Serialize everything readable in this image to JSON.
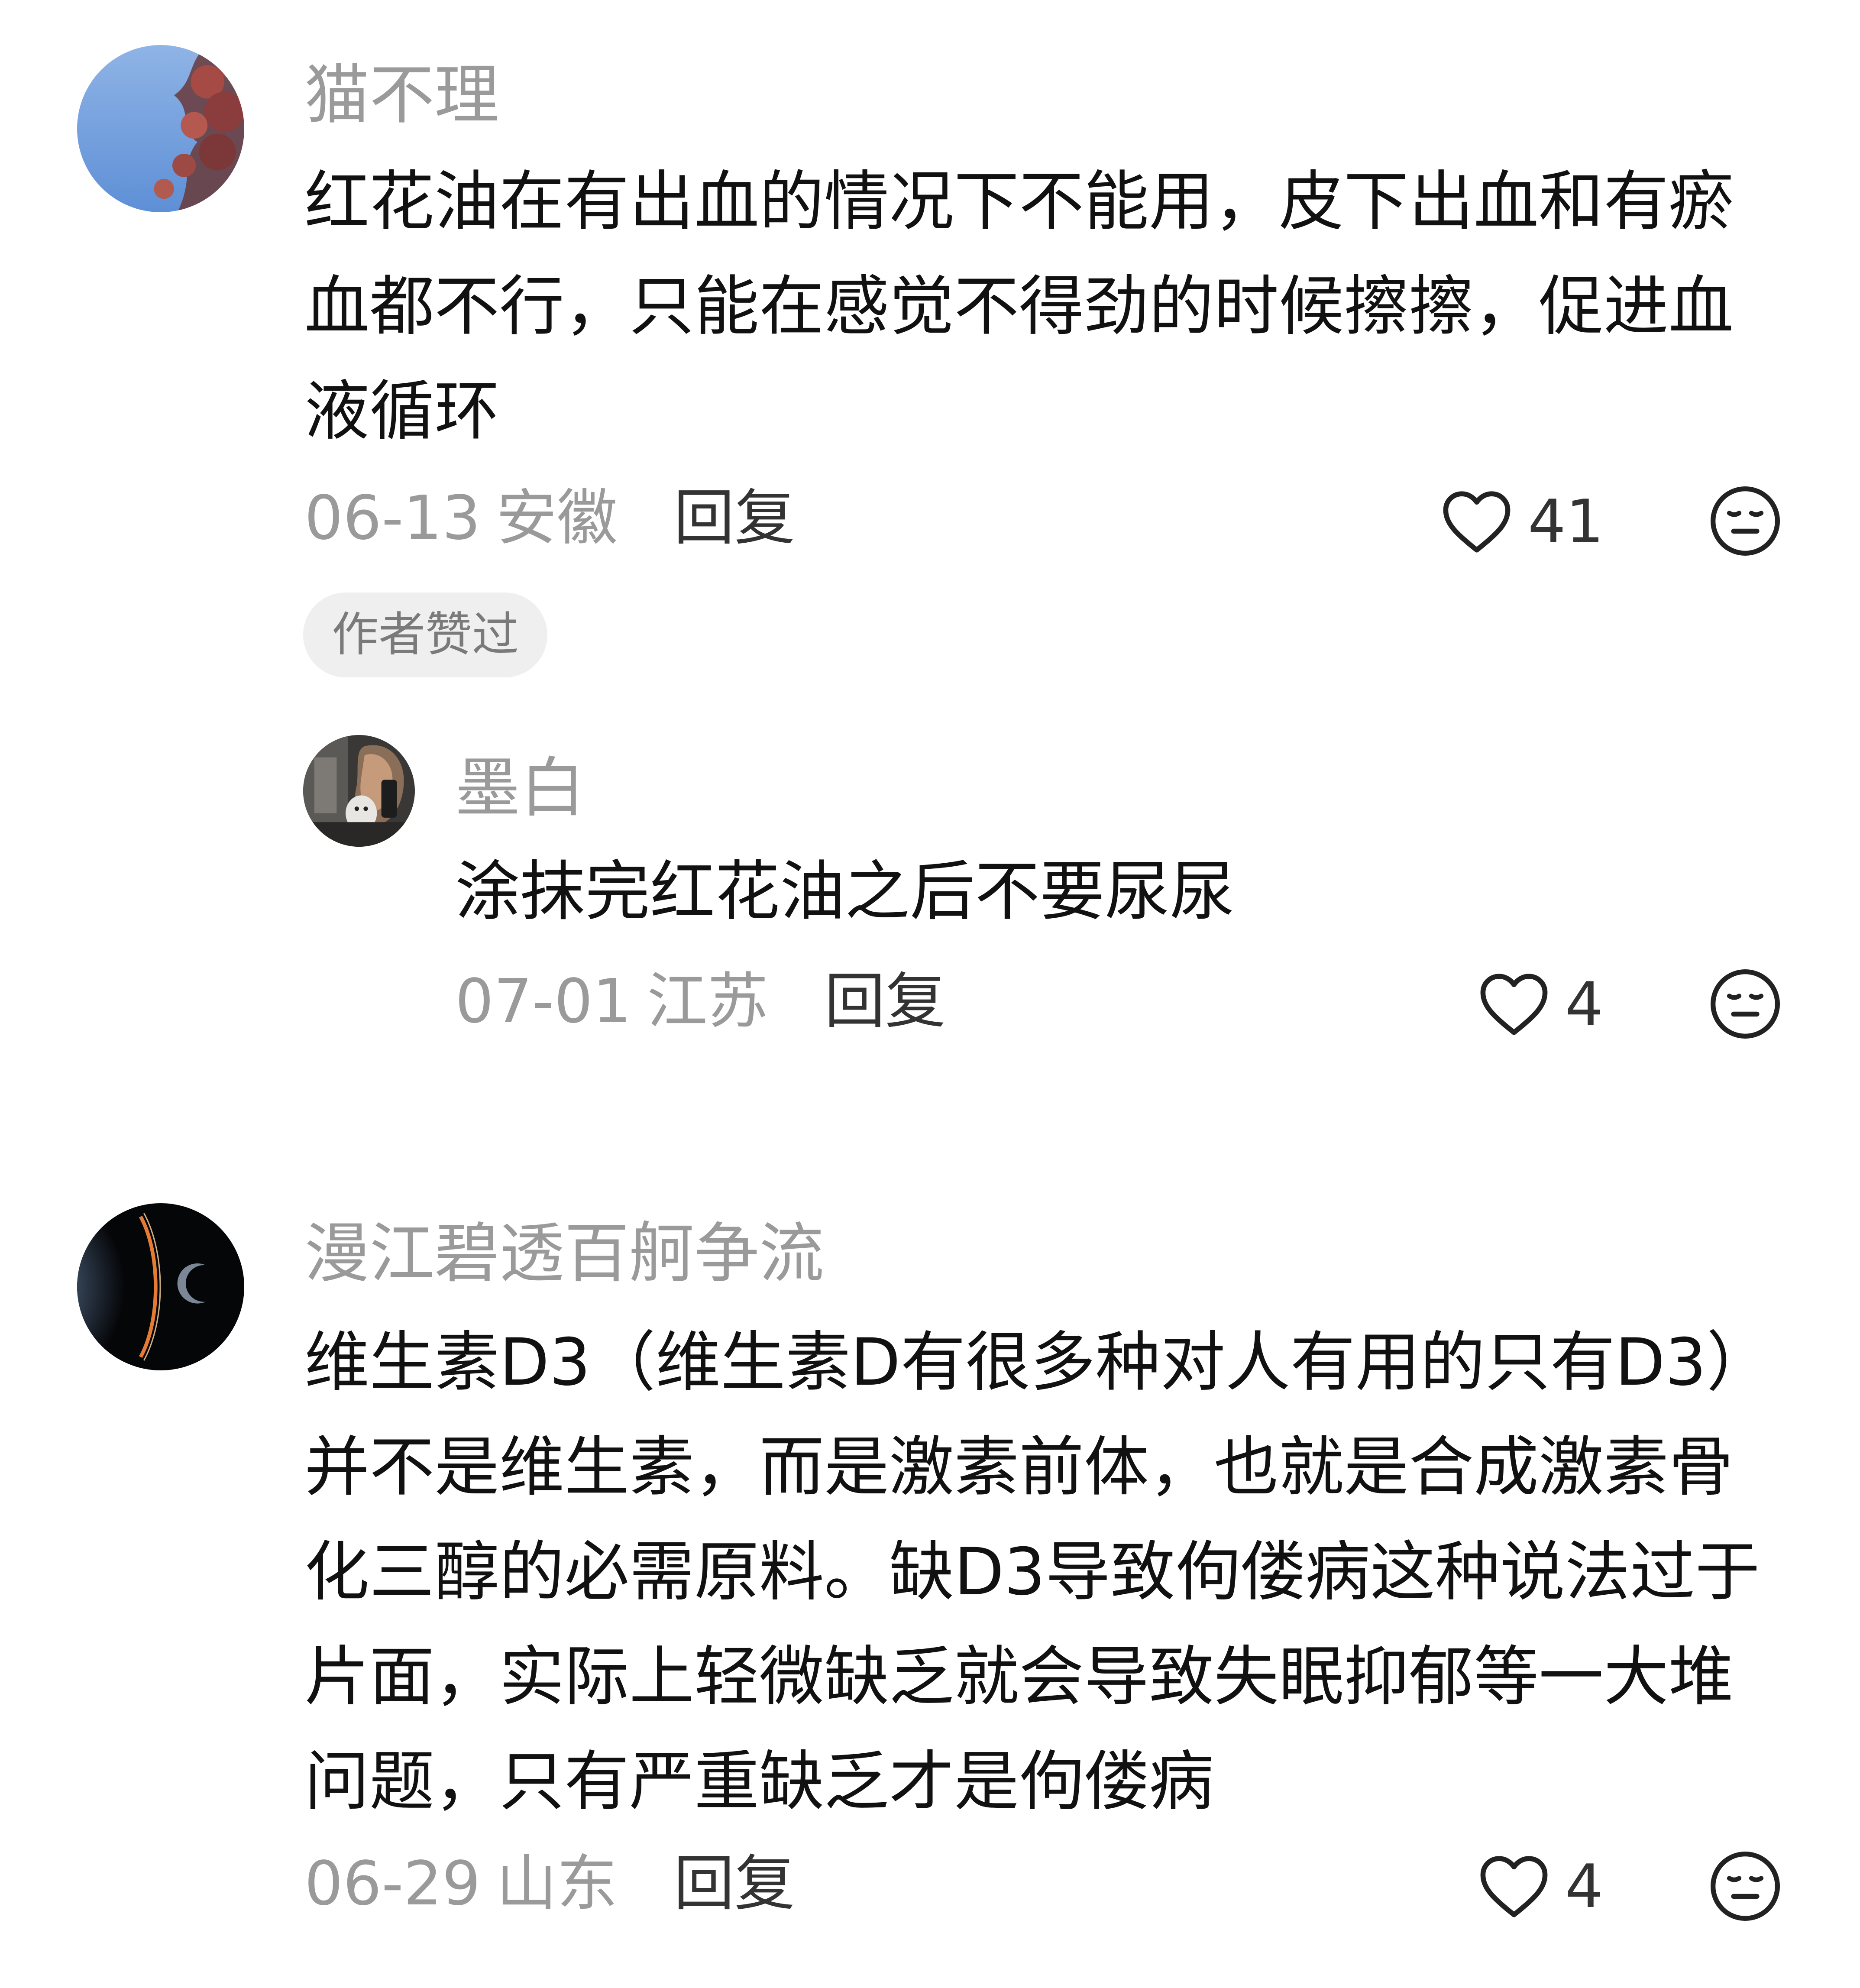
{
  "comments": [
    {
      "username": "猫不理",
      "text": "红花油在有出血的情况下不能用，皮下出血和有瘀血都不行，只能在感觉不得劲的时候擦擦，促进血液循环",
      "date": "06-13",
      "location": "安徽",
      "reply_label": "回复",
      "likes": "41",
      "badge": "作者赞过",
      "replies": [
        {
          "username": "墨白",
          "text": "涂抹完红花油之后不要尿尿",
          "date": "07-01",
          "location": "江苏",
          "reply_label": "回复",
          "likes": "4"
        }
      ]
    },
    {
      "username": "漫江碧透百舸争流",
      "text": "维生素D3（维生素D有很多种对人有用的只有D3）并不是维生素，而是激素前体，也就是合成激素骨化三醇的必需原料。缺D3导致佝偻病这种说法过于片面，实际上轻微缺乏就会导致失眠抑郁等一大堆问题，只有严重缺乏才是佝偻病",
      "date": "06-29",
      "location": "山东",
      "reply_label": "回复",
      "likes": "4"
    }
  ],
  "icons": {
    "like": "heart-outline-icon",
    "dislike": "neutral-face-icon"
  },
  "colors": {
    "text_primary": "#111111",
    "text_secondary": "#9a9a9a",
    "badge_bg": "#efefef"
  }
}
